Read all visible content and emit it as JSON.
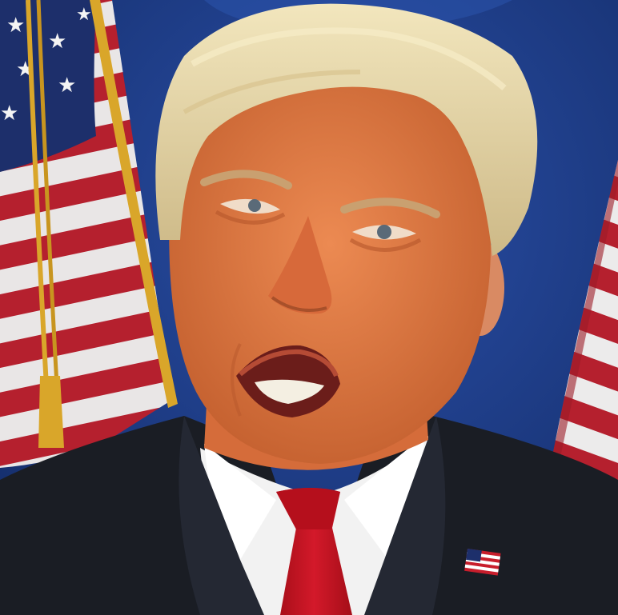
{
  "scene": {
    "description_visible_text": [],
    "colors": {
      "backdrop": "#1f3f92",
      "backdrop_dark": "#16306f",
      "flag_red": "#b5202e",
      "flag_white": "#eeeeee",
      "flag_blue": "#1d2f6b",
      "fringe_gold": "#d9a62a",
      "skin": "#e07a45",
      "skin_shadow": "#c4602f",
      "hair": "#e9d9a6",
      "suit": "#1a1d24",
      "shirt": "#f2f2f2",
      "tie": "#c3121e",
      "mouth": "#6b1d1a",
      "teeth": "#f4efe2"
    },
    "elements": [
      "backdrop",
      "left-flag",
      "right-flag",
      "person",
      "hair",
      "face",
      "open-mouth",
      "suit-jacket",
      "shirt-collar",
      "red-tie",
      "flag-lapel-pin"
    ]
  }
}
